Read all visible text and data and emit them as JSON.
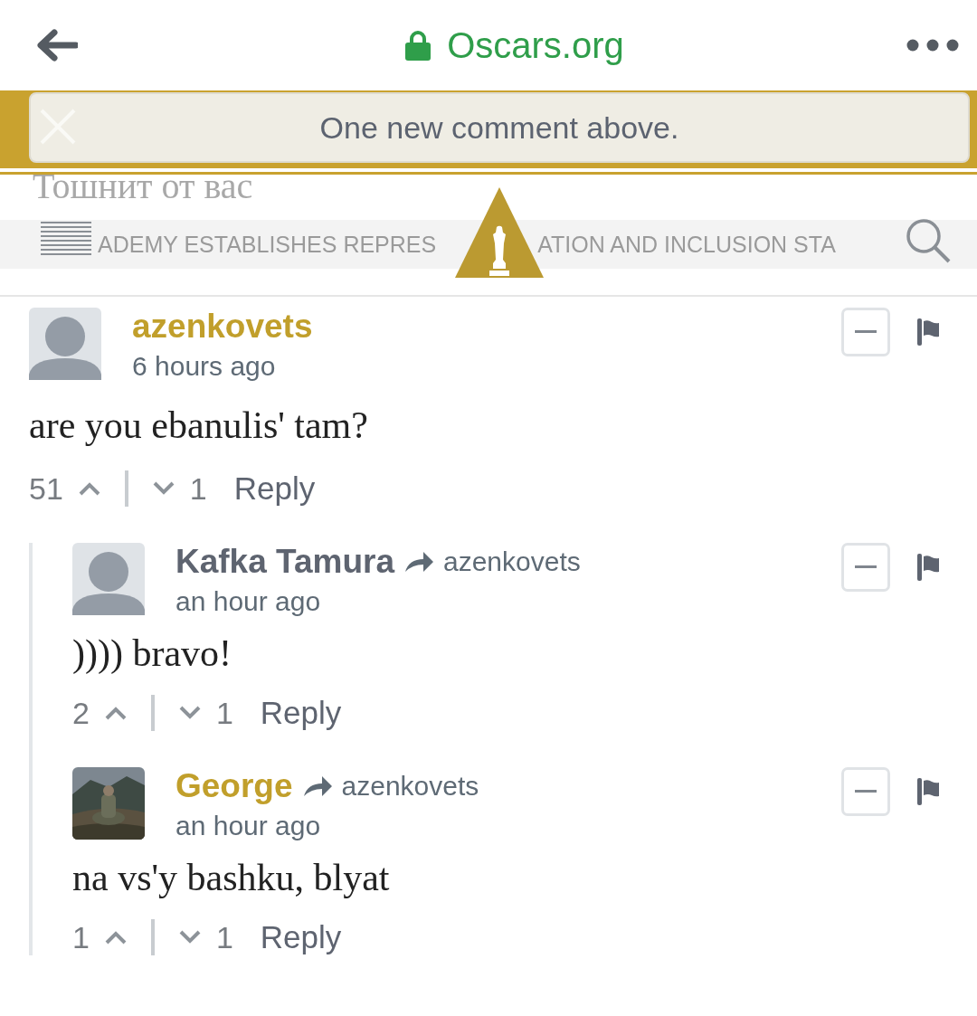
{
  "browser": {
    "site": "Oscars.org"
  },
  "notice": {
    "text": "One new comment above."
  },
  "background_texts": [
    {
      "text": "Тошнит от вас"
    },
    {
      "text": "ADEMY ESTABLISHES REPRES"
    },
    {
      "text": "ATION AND INCLUSION STA"
    }
  ],
  "comments": [
    {
      "author": "azenkovets",
      "color": "#c19f2b",
      "kind": "default",
      "time": "6 hours ago",
      "body": "are you ebanulis' tam?",
      "upvotes": "51",
      "downvotes": "1",
      "reply": "Reply",
      "children": [
        {
          "author": "Kafka Tamura",
          "color": "#5e6470",
          "kind": "default",
          "reply_to": "azenkovets",
          "time": "an hour ago",
          "body": ")))) bravo!",
          "upvotes": "2",
          "downvotes": "1",
          "reply": "Reply"
        },
        {
          "author": "George",
          "color": "#c19f2b",
          "kind": "picture",
          "reply_to": "azenkovets",
          "time": "an hour ago",
          "body": "na vs'y bashku, blyat",
          "upvotes": "1",
          "downvotes": "1",
          "reply": "Reply"
        }
      ]
    }
  ]
}
